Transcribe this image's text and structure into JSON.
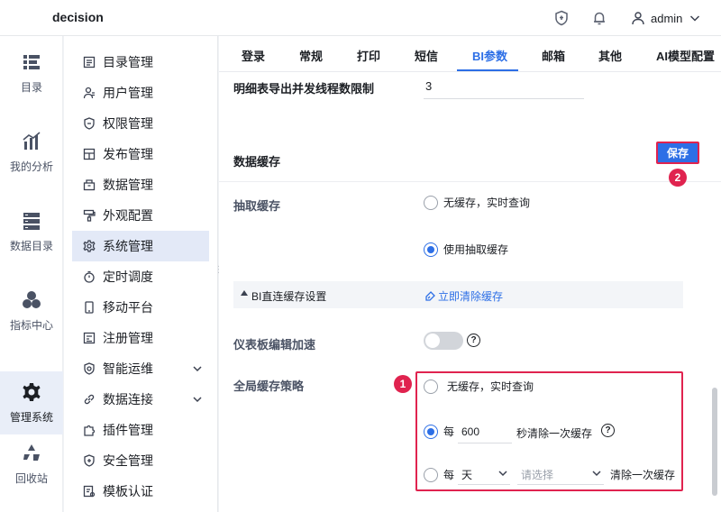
{
  "app": {
    "title": "decision"
  },
  "header": {
    "user_name": "admin"
  },
  "rail": {
    "items": [
      {
        "label": "目录",
        "icon": "list-icon"
      },
      {
        "label": "我的分析",
        "icon": "chart-icon"
      },
      {
        "label": "数据目录",
        "icon": "database-icon"
      },
      {
        "label": "指标中心",
        "icon": "cubes-icon"
      },
      {
        "label": "管理系统",
        "icon": "gear-icon"
      },
      {
        "label": "回收站",
        "icon": "recycle-icon"
      }
    ],
    "active": "管理系统"
  },
  "submenu": {
    "items": [
      {
        "label": "目录管理"
      },
      {
        "label": "用户管理"
      },
      {
        "label": "权限管理"
      },
      {
        "label": "发布管理"
      },
      {
        "label": "数据管理"
      },
      {
        "label": "外观配置"
      },
      {
        "label": "系统管理"
      },
      {
        "label": "定时调度"
      },
      {
        "label": "移动平台"
      },
      {
        "label": "注册管理"
      },
      {
        "label": "智能运维"
      },
      {
        "label": "数据连接"
      },
      {
        "label": "插件管理"
      },
      {
        "label": "安全管理"
      },
      {
        "label": "模板认证"
      }
    ],
    "active": "系统管理"
  },
  "tabs": {
    "items": [
      "登录",
      "常规",
      "打印",
      "短信",
      "BI参数",
      "邮箱",
      "其他",
      "AI模型配置"
    ],
    "active": "BI参数"
  },
  "settings": {
    "detail_export_label": "明细表导出并发线程数限制",
    "detail_export_value": "3"
  },
  "cache": {
    "section_title": "数据缓存",
    "save_label": "保存",
    "badge_save": "2",
    "extract_label": "抽取缓存",
    "extract_option_no_cache": "无缓存，实时查询",
    "extract_option_use": "使用抽取缓存",
    "direct_title": "BI直连缓存设置",
    "clear_link": "立即清除缓存",
    "dashboard_accel_label": "仪表板编辑加速",
    "global_label": "全局缓存策略",
    "badge_global": "1",
    "global_no_cache": "无缓存，实时查询",
    "global_every": "每",
    "global_seconds_value": "600",
    "global_seconds_suffix": "秒清除一次缓存",
    "global_every2": "每",
    "global_unit": "天",
    "global_select_placeholder": "请选择",
    "global_day_suffix": "清除一次缓存"
  },
  "colors": {
    "accent": "#2d6fe6",
    "highlight": "#e0234f"
  }
}
